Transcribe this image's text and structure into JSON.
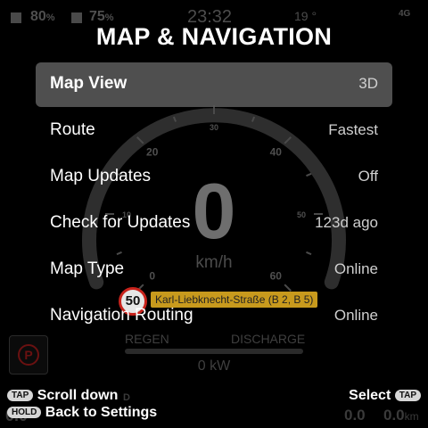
{
  "status": {
    "battery_1": "80",
    "battery_1_unit": "%",
    "battery_2": "75",
    "battery_2_unit": "%",
    "clock": "23:32",
    "temperature": "19 °",
    "network": "4G"
  },
  "gauge": {
    "ticks": [
      "0",
      "10",
      "20",
      "30",
      "40",
      "50",
      "60"
    ],
    "speed": "0",
    "unit": "km/h"
  },
  "speed_limit": "50",
  "street": "Karl-Liebknecht-Straße (B 2, B 5)",
  "power": {
    "regen_label": "REGEN",
    "discharge_label": "DISCHARGE",
    "value": "0 kW"
  },
  "parking_brake_icon": "P",
  "bottom_stats": {
    "left_value": "0.0",
    "d_label": "D",
    "trip_1": "0.0",
    "trip_2": "0.0",
    "trip_unit": "km"
  },
  "menu": {
    "title": "MAP & NAVIGATION",
    "selected_index": 0,
    "items": [
      {
        "label": "Map View",
        "value": "3D"
      },
      {
        "label": "Route",
        "value": "Fastest"
      },
      {
        "label": "Map Updates",
        "value": "Off"
      },
      {
        "label": "Check for Updates",
        "value": "123d ago"
      },
      {
        "label": "Map Type",
        "value": "Online"
      },
      {
        "label": "Navigation Routing",
        "value": "Online"
      }
    ]
  },
  "hints": {
    "tap_badge": "TAP",
    "tap_action": "Scroll down",
    "hold_badge": "HOLD",
    "hold_action": "Back to Settings",
    "select_action": "Select",
    "select_badge": "TAP"
  },
  "colors": {
    "selected_row_bg": "#5a5a5a",
    "speed_sign_border": "#c8231c",
    "street_label_bg": "#c89a1d"
  }
}
